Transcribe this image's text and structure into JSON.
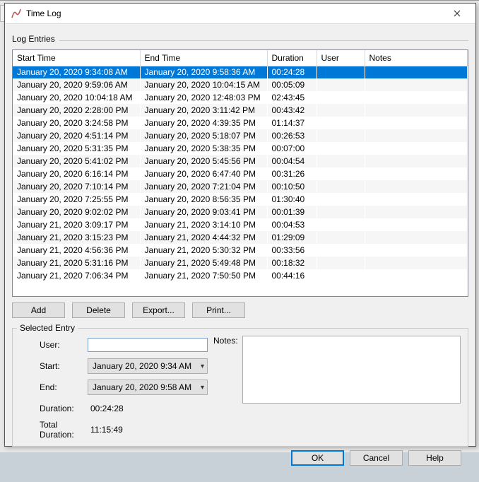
{
  "window": {
    "title": "Time Log"
  },
  "groups": {
    "log": "Log Entries",
    "selected": "Selected Entry"
  },
  "columns": {
    "start": "Start Time",
    "end": "End Time",
    "duration": "Duration",
    "user": "User",
    "notes": "Notes"
  },
  "rows": [
    {
      "start": "January 20, 2020 9:34:08 AM",
      "end": "January 20, 2020 9:58:36 AM",
      "duration": "00:24:28",
      "user": "",
      "notes": ""
    },
    {
      "start": "January 20, 2020 9:59:06 AM",
      "end": "January 20, 2020 10:04:15 AM",
      "duration": "00:05:09",
      "user": "",
      "notes": ""
    },
    {
      "start": "January 20, 2020 10:04:18 AM",
      "end": "January 20, 2020 12:48:03 PM",
      "duration": "02:43:45",
      "user": "",
      "notes": ""
    },
    {
      "start": "January 20, 2020 2:28:00 PM",
      "end": "January 20, 2020 3:11:42 PM",
      "duration": "00:43:42",
      "user": "",
      "notes": ""
    },
    {
      "start": "January 20, 2020 3:24:58 PM",
      "end": "January 20, 2020 4:39:35 PM",
      "duration": "01:14:37",
      "user": "",
      "notes": ""
    },
    {
      "start": "January 20, 2020 4:51:14 PM",
      "end": "January 20, 2020 5:18:07 PM",
      "duration": "00:26:53",
      "user": "",
      "notes": ""
    },
    {
      "start": "January 20, 2020 5:31:35 PM",
      "end": "January 20, 2020 5:38:35 PM",
      "duration": "00:07:00",
      "user": "",
      "notes": ""
    },
    {
      "start": "January 20, 2020 5:41:02 PM",
      "end": "January 20, 2020 5:45:56 PM",
      "duration": "00:04:54",
      "user": "",
      "notes": ""
    },
    {
      "start": "January 20, 2020 6:16:14 PM",
      "end": "January 20, 2020 6:47:40 PM",
      "duration": "00:31:26",
      "user": "",
      "notes": ""
    },
    {
      "start": "January 20, 2020 7:10:14 PM",
      "end": "January 20, 2020 7:21:04 PM",
      "duration": "00:10:50",
      "user": "",
      "notes": ""
    },
    {
      "start": "January 20, 2020 7:25:55 PM",
      "end": "January 20, 2020 8:56:35 PM",
      "duration": "01:30:40",
      "user": "",
      "notes": ""
    },
    {
      "start": "January 20, 2020 9:02:02 PM",
      "end": "January 20, 2020 9:03:41 PM",
      "duration": "00:01:39",
      "user": "",
      "notes": ""
    },
    {
      "start": "January 21, 2020 3:09:17 PM",
      "end": "January 21, 2020 3:14:10 PM",
      "duration": "00:04:53",
      "user": "",
      "notes": ""
    },
    {
      "start": "January 21, 2020 3:15:23 PM",
      "end": "January 21, 2020 4:44:32 PM",
      "duration": "01:29:09",
      "user": "",
      "notes": ""
    },
    {
      "start": "January 21, 2020 4:56:36 PM",
      "end": "January 21, 2020 5:30:32 PM",
      "duration": "00:33:56",
      "user": "",
      "notes": ""
    },
    {
      "start": "January 21, 2020 5:31:16 PM",
      "end": "January 21, 2020 5:49:48 PM",
      "duration": "00:18:32",
      "user": "",
      "notes": ""
    },
    {
      "start": "January 21, 2020 7:06:34 PM",
      "end": "January 21, 2020 7:50:50 PM",
      "duration": "00:44:16",
      "user": "",
      "notes": ""
    }
  ],
  "selected_index": 0,
  "buttons": {
    "add": "Add",
    "delete": "Delete",
    "export": "Export...",
    "print": "Print..."
  },
  "form": {
    "user_label": "User:",
    "notes_label": "Notes:",
    "start_label": "Start:",
    "end_label": "End:",
    "duration_label": "Duration:",
    "total_label": "Total Duration:",
    "user_value": "",
    "start_value": "January 20, 2020 9:34 AM",
    "end_value": "January 20, 2020 9:58 AM",
    "duration_value": "00:24:28",
    "total_value": "11:15:49",
    "notes_value": ""
  },
  "footer": {
    "ok": "OK",
    "cancel": "Cancel",
    "help": "Help"
  }
}
